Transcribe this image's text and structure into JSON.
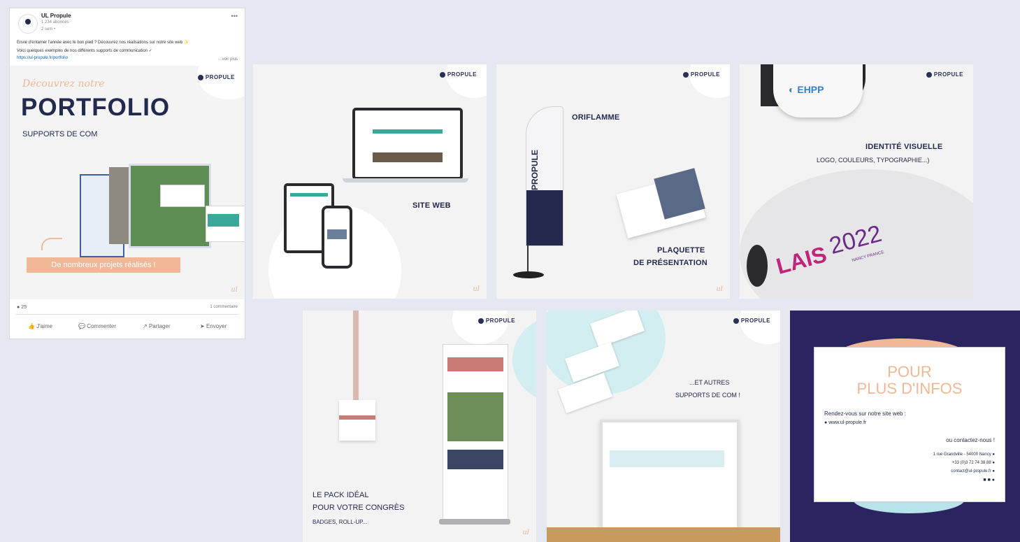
{
  "post": {
    "page_name": "UL Propule",
    "followers": "1 234 abonnés",
    "time": "2 sem •",
    "text_line1": "Envie d'entamer l'année avec le bon pied ? Découvrez nos réalisations sur notre site web ✨",
    "text_line2": "Voici quelques exemples de nos différents supports de communication ✓",
    "link_text": "https://ul-propule.fr/portfolio",
    "see_more": "…voir plus",
    "reactions": "25",
    "comments_count": "1 commentaire",
    "actions": {
      "like": "J'aime",
      "comment": "Commenter",
      "share": "Partager",
      "send": "Envoyer"
    }
  },
  "cover": {
    "script": "Découvrez notre",
    "title": "PORTFOLIO",
    "subtitle": "SUPPORTS DE COM",
    "cta": "De nombreux projets réalisés !"
  },
  "brand": "PROPULE",
  "cards": {
    "site_web": "SITE WEB",
    "oriflamme": "ORIFLAMME",
    "plaquette_1": "PLAQUETTE",
    "plaquette_2": "DE PRÉSENTATION",
    "identite_1": "IDENTITÉ VISUELLE",
    "identite_2": "LOGO, COULEURS, TYPOGRAPHIE...)",
    "lais_year": "2022",
    "lais_logo": "LAIS",
    "lais_city": "NANCY FRANCE",
    "ehpp": "EHPP",
    "pack_1": "LE PACK IDÉAL",
    "pack_2": "POUR VOTRE CONGRÈS",
    "pack_3": "BADGES, ROLL-UP...",
    "autres_1": "...ET AUTRES",
    "autres_2": "SUPPORTS DE COM !",
    "flag_text": "PROPULE"
  },
  "contact": {
    "title_1": "POUR",
    "title_2": "PLUS D'INFOS",
    "visit": "Rendez-vous sur notre site web :",
    "url": "www.ul-propule.fr",
    "or": "ou contactez-nous !",
    "address": "1 rue Grandville - 54000 Nancy",
    "phone": "+33 (0)3 72 74 38 88",
    "email": "contact@ul-propule.fr"
  },
  "colors": {
    "navy": "#242a4d",
    "peach": "#f0b896",
    "teal": "#3aa89a",
    "page_bg": "#e6e8f1"
  }
}
